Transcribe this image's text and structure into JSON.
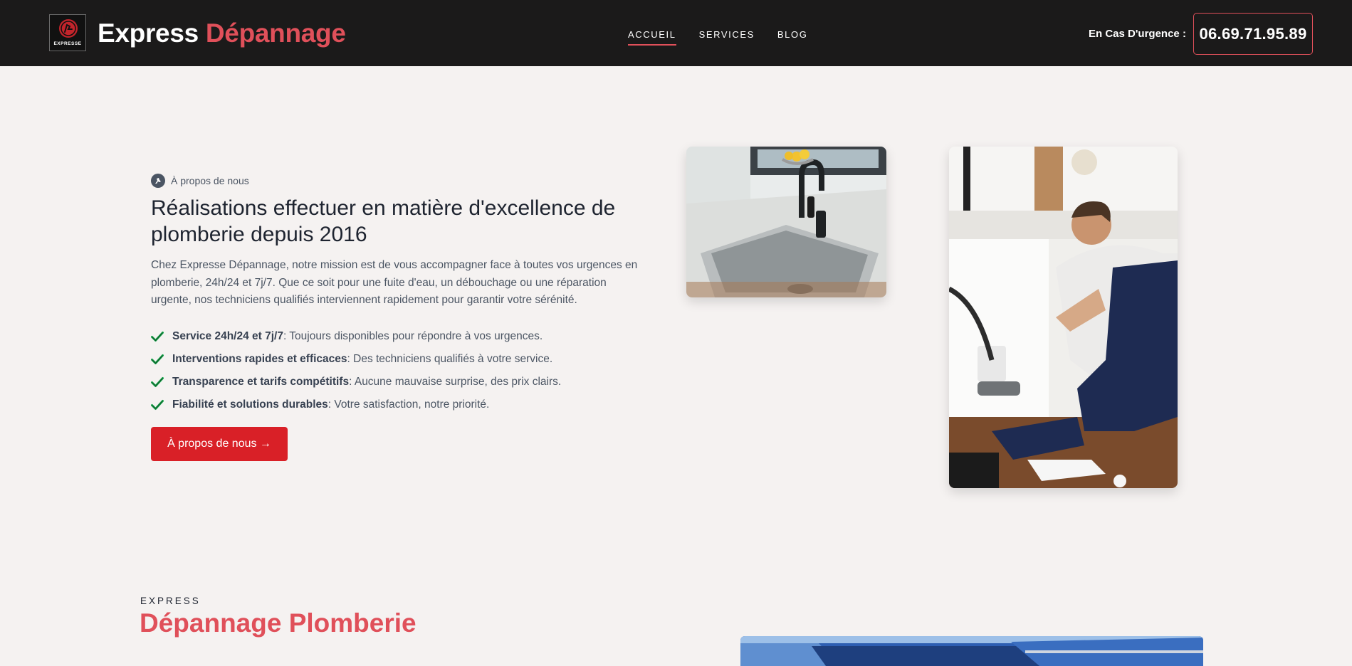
{
  "header": {
    "logo_text": "EXPRESSE",
    "brand_main": "Express",
    "brand_accent": "Dépannage",
    "nav": [
      {
        "label": "ACCUEIL",
        "active": true
      },
      {
        "label": "SERVICES",
        "active": false
      },
      {
        "label": "BLOG",
        "active": false
      }
    ],
    "urgent_label": "En Cas D'urgence :",
    "phone": "06.69.71.95.89"
  },
  "about": {
    "eyebrow": "À propos de nous",
    "title": "Réalisations effectuer en matière d'excellence de plomberie depuis 2016",
    "description": "Chez Expresse Dépannage, notre mission est de vous accompagner face à toutes vos urgences en plomberie, 24h/24 et 7j/7. Que ce soit pour une fuite d'eau, un débouchage ou une réparation urgente, nos techniciens qualifiés interviennent rapidement pour garantir votre sérénité.",
    "features": [
      {
        "bold": "Service 24h/24 et 7j/7",
        "text": ": Toujours disponibles pour répondre à vos urgences."
      },
      {
        "bold": "Interventions rapides et efficaces",
        "text": ": Des techniciens qualifiés à votre service."
      },
      {
        "bold": "Transparence et tarifs compétitifs",
        "text": ": Aucune mauvaise surprise, des prix clairs."
      },
      {
        "bold": "Fiabilité et solutions durables",
        "text": ": Votre satisfaction, notre priorité."
      }
    ],
    "cta_label": "À propos de nous →"
  },
  "section2": {
    "eyebrow": "EXPRESS",
    "title": "Dépannage Plomberie"
  },
  "colors": {
    "header_bg": "#1b1a1a",
    "accent": "#e0505a",
    "cta_bg": "#d92027",
    "page_bg": "#f5f2f1",
    "check": "#16a34a"
  }
}
